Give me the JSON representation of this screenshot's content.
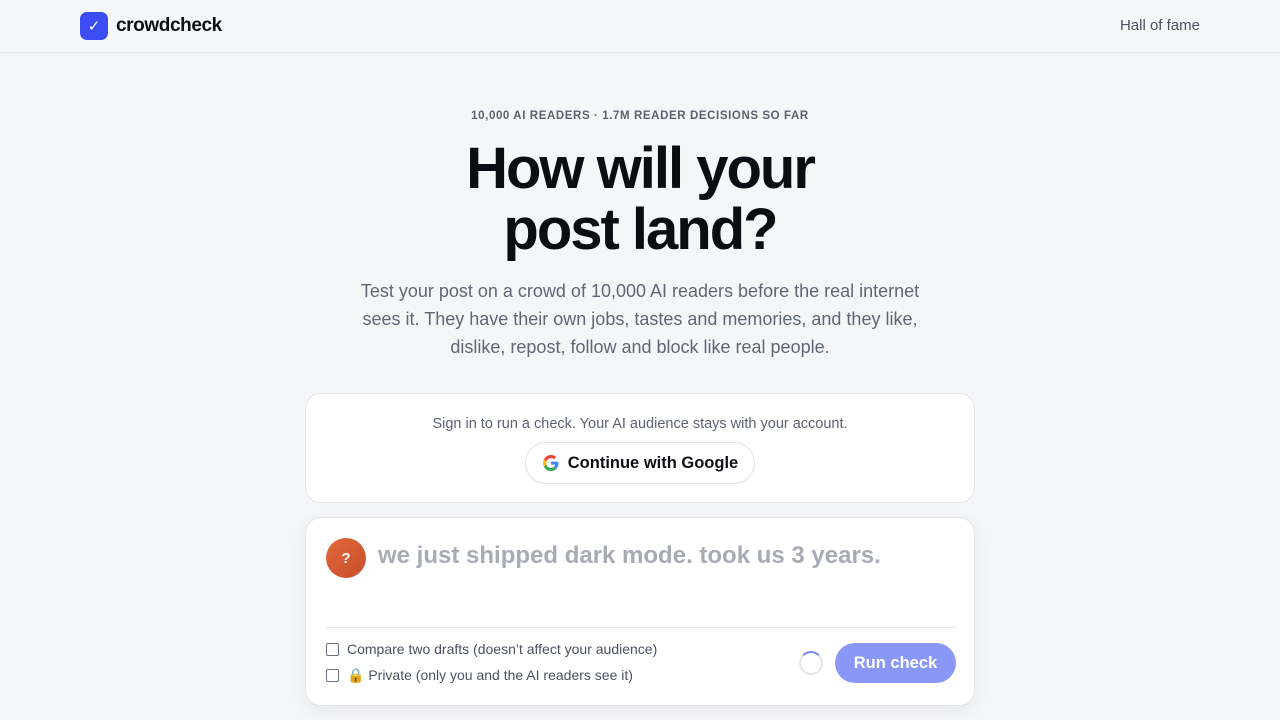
{
  "header": {
    "brand": {
      "mark": "✓",
      "name": "crowdcheck"
    },
    "nav": {
      "hall_of_fame": "Hall of fame"
    }
  },
  "hero": {
    "eyebrow": "10,000 AI READERS · 1.7M READER DECISIONS SO FAR",
    "headline_line1": "How will your",
    "headline_line2": "post land?",
    "lede": "Test your post on a crowd of 10,000 AI readers before the real internet sees it. They have their own jobs, tastes and memories, and they like, dislike, repost, follow and block like real people."
  },
  "signin": {
    "prompt": "Sign in to run a check. Your AI audience stays with your account.",
    "google_label": "Continue with Google",
    "google_icon": "google-icon"
  },
  "composer": {
    "avatar": "?",
    "placeholder": "we just shipped dark mode. took us 3 years.",
    "value": "",
    "compare_label": "Compare two drafts  (doesn’t affect your audience)",
    "private_label": "🔒 Private (only you and the AI readers see it)",
    "run_label": "Run check"
  },
  "colors": {
    "accent": "#3a4cf2",
    "run_button": "#8a97f7",
    "avatar": "#d95a33"
  }
}
